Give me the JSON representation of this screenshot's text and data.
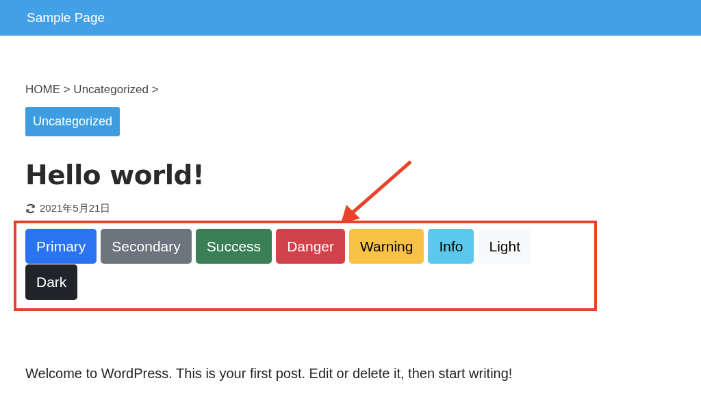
{
  "navbar": {
    "brand": "Sample Page"
  },
  "breadcrumb": "HOME > Uncategorized >",
  "category_badge": "Uncategorized",
  "post": {
    "title": "Hello world!",
    "updated_date": "2021年5月21日"
  },
  "buttons": [
    {
      "label": "Primary",
      "color": "#2a74f2"
    },
    {
      "label": "Secondary",
      "color": "#6c757d"
    },
    {
      "label": "Success",
      "color": "#3b7f57"
    },
    {
      "label": "Danger",
      "color": "#d0434b"
    },
    {
      "label": "Warning",
      "color": "#f7c245"
    },
    {
      "label": "Info",
      "color": "#5cc8ed"
    },
    {
      "label": "Light",
      "color": "#f8f9fa"
    },
    {
      "label": "Dark",
      "color": "#212529"
    }
  ],
  "body_text": "Welcome to WordPress. This is your first post. Edit or delete it, then start writing!"
}
